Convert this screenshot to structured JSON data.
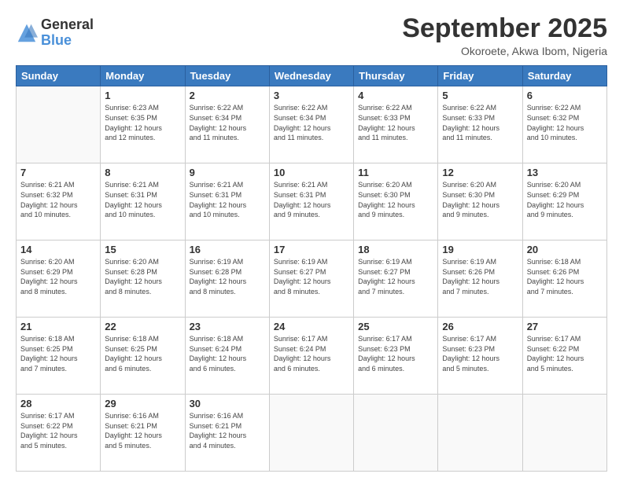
{
  "header": {
    "logo": {
      "line1": "General",
      "line2": "Blue"
    },
    "title": "September 2025",
    "location": "Okoroete, Akwa Ibom, Nigeria"
  },
  "calendar": {
    "weekdays": [
      "Sunday",
      "Monday",
      "Tuesday",
      "Wednesday",
      "Thursday",
      "Friday",
      "Saturday"
    ],
    "weeks": [
      [
        {
          "day": "",
          "info": ""
        },
        {
          "day": "1",
          "info": "Sunrise: 6:23 AM\nSunset: 6:35 PM\nDaylight: 12 hours\nand 12 minutes."
        },
        {
          "day": "2",
          "info": "Sunrise: 6:22 AM\nSunset: 6:34 PM\nDaylight: 12 hours\nand 11 minutes."
        },
        {
          "day": "3",
          "info": "Sunrise: 6:22 AM\nSunset: 6:34 PM\nDaylight: 12 hours\nand 11 minutes."
        },
        {
          "day": "4",
          "info": "Sunrise: 6:22 AM\nSunset: 6:33 PM\nDaylight: 12 hours\nand 11 minutes."
        },
        {
          "day": "5",
          "info": "Sunrise: 6:22 AM\nSunset: 6:33 PM\nDaylight: 12 hours\nand 11 minutes."
        },
        {
          "day": "6",
          "info": "Sunrise: 6:22 AM\nSunset: 6:32 PM\nDaylight: 12 hours\nand 10 minutes."
        }
      ],
      [
        {
          "day": "7",
          "info": "Sunrise: 6:21 AM\nSunset: 6:32 PM\nDaylight: 12 hours\nand 10 minutes."
        },
        {
          "day": "8",
          "info": "Sunrise: 6:21 AM\nSunset: 6:31 PM\nDaylight: 12 hours\nand 10 minutes."
        },
        {
          "day": "9",
          "info": "Sunrise: 6:21 AM\nSunset: 6:31 PM\nDaylight: 12 hours\nand 10 minutes."
        },
        {
          "day": "10",
          "info": "Sunrise: 6:21 AM\nSunset: 6:31 PM\nDaylight: 12 hours\nand 9 minutes."
        },
        {
          "day": "11",
          "info": "Sunrise: 6:20 AM\nSunset: 6:30 PM\nDaylight: 12 hours\nand 9 minutes."
        },
        {
          "day": "12",
          "info": "Sunrise: 6:20 AM\nSunset: 6:30 PM\nDaylight: 12 hours\nand 9 minutes."
        },
        {
          "day": "13",
          "info": "Sunrise: 6:20 AM\nSunset: 6:29 PM\nDaylight: 12 hours\nand 9 minutes."
        }
      ],
      [
        {
          "day": "14",
          "info": "Sunrise: 6:20 AM\nSunset: 6:29 PM\nDaylight: 12 hours\nand 8 minutes."
        },
        {
          "day": "15",
          "info": "Sunrise: 6:20 AM\nSunset: 6:28 PM\nDaylight: 12 hours\nand 8 minutes."
        },
        {
          "day": "16",
          "info": "Sunrise: 6:19 AM\nSunset: 6:28 PM\nDaylight: 12 hours\nand 8 minutes."
        },
        {
          "day": "17",
          "info": "Sunrise: 6:19 AM\nSunset: 6:27 PM\nDaylight: 12 hours\nand 8 minutes."
        },
        {
          "day": "18",
          "info": "Sunrise: 6:19 AM\nSunset: 6:27 PM\nDaylight: 12 hours\nand 7 minutes."
        },
        {
          "day": "19",
          "info": "Sunrise: 6:19 AM\nSunset: 6:26 PM\nDaylight: 12 hours\nand 7 minutes."
        },
        {
          "day": "20",
          "info": "Sunrise: 6:18 AM\nSunset: 6:26 PM\nDaylight: 12 hours\nand 7 minutes."
        }
      ],
      [
        {
          "day": "21",
          "info": "Sunrise: 6:18 AM\nSunset: 6:25 PM\nDaylight: 12 hours\nand 7 minutes."
        },
        {
          "day": "22",
          "info": "Sunrise: 6:18 AM\nSunset: 6:25 PM\nDaylight: 12 hours\nand 6 minutes."
        },
        {
          "day": "23",
          "info": "Sunrise: 6:18 AM\nSunset: 6:24 PM\nDaylight: 12 hours\nand 6 minutes."
        },
        {
          "day": "24",
          "info": "Sunrise: 6:17 AM\nSunset: 6:24 PM\nDaylight: 12 hours\nand 6 minutes."
        },
        {
          "day": "25",
          "info": "Sunrise: 6:17 AM\nSunset: 6:23 PM\nDaylight: 12 hours\nand 6 minutes."
        },
        {
          "day": "26",
          "info": "Sunrise: 6:17 AM\nSunset: 6:23 PM\nDaylight: 12 hours\nand 5 minutes."
        },
        {
          "day": "27",
          "info": "Sunrise: 6:17 AM\nSunset: 6:22 PM\nDaylight: 12 hours\nand 5 minutes."
        }
      ],
      [
        {
          "day": "28",
          "info": "Sunrise: 6:17 AM\nSunset: 6:22 PM\nDaylight: 12 hours\nand 5 minutes."
        },
        {
          "day": "29",
          "info": "Sunrise: 6:16 AM\nSunset: 6:21 PM\nDaylight: 12 hours\nand 5 minutes."
        },
        {
          "day": "30",
          "info": "Sunrise: 6:16 AM\nSunset: 6:21 PM\nDaylight: 12 hours\nand 4 minutes."
        },
        {
          "day": "",
          "info": ""
        },
        {
          "day": "",
          "info": ""
        },
        {
          "day": "",
          "info": ""
        },
        {
          "day": "",
          "info": ""
        }
      ]
    ]
  }
}
